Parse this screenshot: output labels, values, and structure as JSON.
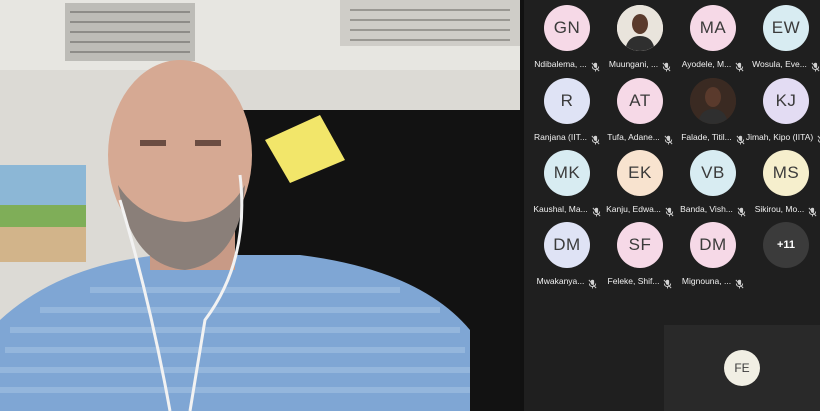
{
  "participants": [
    {
      "initials": "GN",
      "name": "Ndibalema, ...",
      "color": "#f6d9e7",
      "photo": false
    },
    {
      "initials": "",
      "name": "Muungani, ...",
      "color": "#e9e4dc",
      "photo": true
    },
    {
      "initials": "MA",
      "name": "Ayodele, M...",
      "color": "#f6d9e7",
      "photo": false
    },
    {
      "initials": "EW",
      "name": "Wosula, Eve...",
      "color": "#d8ecf2",
      "photo": false
    },
    {
      "initials": "R",
      "name": "Ranjana (IIT...",
      "color": "#dfe3f5",
      "photo": false
    },
    {
      "initials": "AT",
      "name": "Tufa, Adane...",
      "color": "#f6d9e7",
      "photo": false
    },
    {
      "initials": "",
      "name": "Falade, Titil...",
      "color": "#3a2a22",
      "photo": true
    },
    {
      "initials": "KJ",
      "name": "Jimah, Kipo (IITA)",
      "color": "#e3dcf3",
      "photo": false
    },
    {
      "initials": "MK",
      "name": "Kaushal, Ma...",
      "color": "#d8ecf2",
      "photo": false
    },
    {
      "initials": "EK",
      "name": "Kanju, Edwa...",
      "color": "#f8e3cf",
      "photo": false
    },
    {
      "initials": "VB",
      "name": "Banda, Vish...",
      "color": "#d8ecf2",
      "photo": false
    },
    {
      "initials": "MS",
      "name": "Sikirou, Mo...",
      "color": "#f6efcd",
      "photo": false
    },
    {
      "initials": "DM",
      "name": "Mwakanya...",
      "color": "#dfe3f5",
      "photo": false
    },
    {
      "initials": "SF",
      "name": "Feleke, Shif...",
      "color": "#f6d9e7",
      "photo": false
    },
    {
      "initials": "DM",
      "name": "Mignouna, ...",
      "color": "#f6d9e7",
      "photo": false
    }
  ],
  "more_participants": "+11",
  "self_view": {
    "initials": "FE"
  },
  "icons": {
    "mic_muted": "mic-off-icon"
  }
}
